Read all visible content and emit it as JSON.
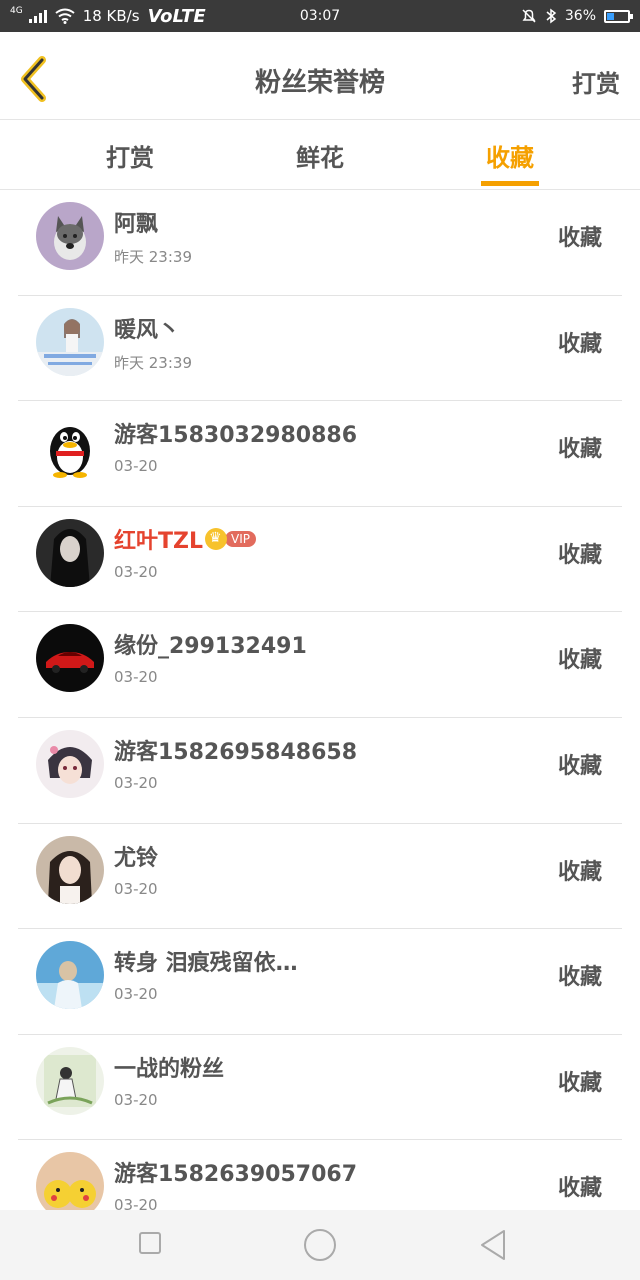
{
  "status_bar": {
    "network_type": "4G",
    "speed": "18 KB/s",
    "volte": "VoLTE",
    "time": "03:07",
    "battery": "36%",
    "battery_level": 0.36
  },
  "header": {
    "title": "粉丝荣誉榜",
    "right_action": "打赏"
  },
  "tabs": [
    {
      "label": "打赏",
      "active": false
    },
    {
      "label": "鲜花",
      "active": false
    },
    {
      "label": "收藏",
      "active": true
    }
  ],
  "list": [
    {
      "name": "阿飘",
      "time": "昨天 23:39",
      "action": "收藏",
      "avatar": "husky-dog"
    },
    {
      "name": "暖风丶",
      "time": "昨天 23:39",
      "action": "收藏",
      "avatar": "girl-photo"
    },
    {
      "name": "游客1583032980886",
      "time": "03-20",
      "action": "收藏",
      "avatar": "qq-penguin"
    },
    {
      "name": "红叶TZL",
      "vip_label": "VIP",
      "time": "03-20",
      "action": "收藏",
      "avatar": "dark-portrait"
    },
    {
      "name": "缘份_299132491",
      "time": "03-20",
      "action": "收藏",
      "avatar": "red-car"
    },
    {
      "name": "游客1582695848658",
      "time": "03-20",
      "action": "收藏",
      "avatar": "anime-character"
    },
    {
      "name": "尤铃",
      "time": "03-20",
      "action": "收藏",
      "avatar": "girl-portrait"
    },
    {
      "name": "转身 泪痕残留依…",
      "time": "03-20",
      "action": "收藏",
      "avatar": "blue-scene"
    },
    {
      "name": "一战的粉丝",
      "time": "03-20",
      "action": "收藏",
      "avatar": "illustration"
    },
    {
      "name": "游客1582639057067",
      "time": "03-20",
      "action": "收藏",
      "avatar": "pikachu"
    }
  ],
  "colors": {
    "accent": "#f5a000",
    "vip_name": "#e5432e",
    "text": "#555555",
    "status_bar_bg": "#3a3a3a"
  }
}
